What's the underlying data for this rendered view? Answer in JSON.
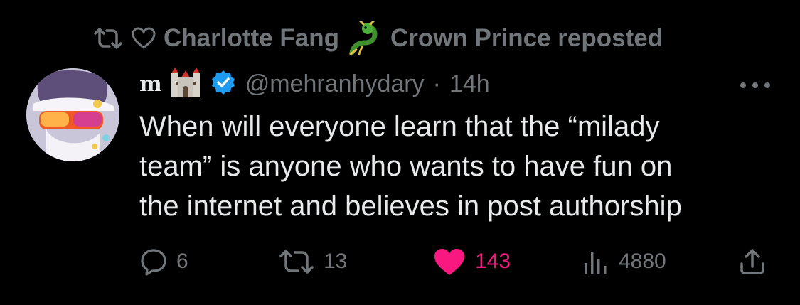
{
  "repost_bar": {
    "text_before_emoji": "Charlotte Fang",
    "text_after_emoji": "Crown Prince reposted"
  },
  "author": {
    "name_mark": "m",
    "handle": "@mehranhydary",
    "separator": "·",
    "time": "14h",
    "verified": true
  },
  "post": {
    "text": "When will everyone learn that the “milady\nteam” is anyone who wants to have fun on\nthe internet and believes in post authorship"
  },
  "actions": {
    "replies": "6",
    "reposts": "13",
    "likes": "143",
    "views": "4880"
  },
  "colors": {
    "background": "#000000",
    "primary_text": "#e7e9ea",
    "secondary_text": "#71767b",
    "like_pink": "#f91880",
    "verified_blue": "#1d9bf0"
  },
  "icons": {
    "repost": "repost-icon",
    "heart_outline": "heart-outline-icon",
    "dragon": "dragon-emoji-icon",
    "castle": "castle-emoji-icon",
    "verified": "verified-badge-icon",
    "more": "more-icon",
    "reply": "reply-icon",
    "like": "heart-filled-icon",
    "views": "views-icon",
    "share": "share-icon"
  }
}
